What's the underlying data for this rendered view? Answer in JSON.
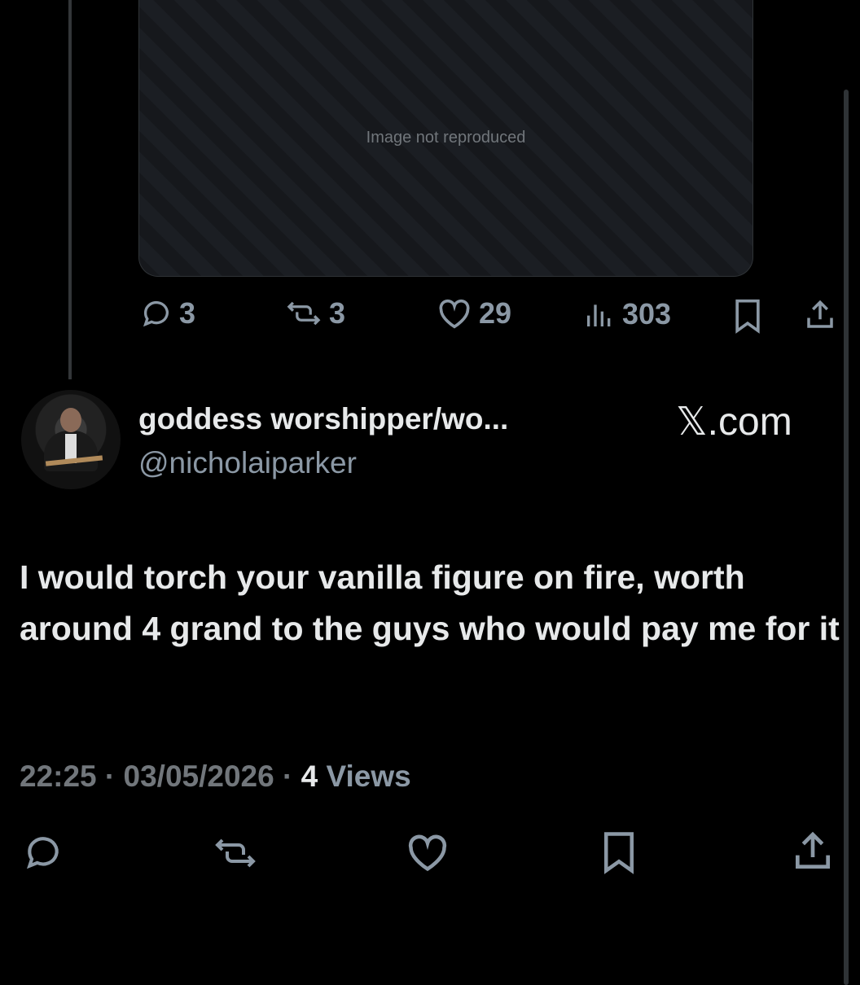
{
  "media": {
    "placeholder": "Image not reproduced"
  },
  "quoted_post_actions": {
    "replies": "3",
    "reposts": "3",
    "likes": "29",
    "views": "303",
    "icons": [
      "reply-icon",
      "repost-icon",
      "like-icon",
      "views-icon",
      "bookmark-icon",
      "share-icon"
    ]
  },
  "author": {
    "display_name": "goddess worshipper/wo...",
    "handle": "@nicholaiparker"
  },
  "brand": {
    "label": "𝕏.com"
  },
  "post": {
    "text": "I would torch your vanilla figure on fire, worth around 4 grand to the guys who would pay me for it"
  },
  "meta": {
    "time": "22:25",
    "sep1": " · ",
    "date": "03/05/2026",
    "sep2": " · ",
    "views_count": "4",
    "views_label": " Views"
  },
  "bottom_actions": {
    "icons": [
      "reply-icon",
      "repost-icon",
      "like-icon",
      "bookmark-icon",
      "share-icon"
    ]
  },
  "colors": {
    "background": "#000000",
    "text": "#e7e9ea",
    "muted": "#71767b",
    "border": "#2f3336"
  }
}
